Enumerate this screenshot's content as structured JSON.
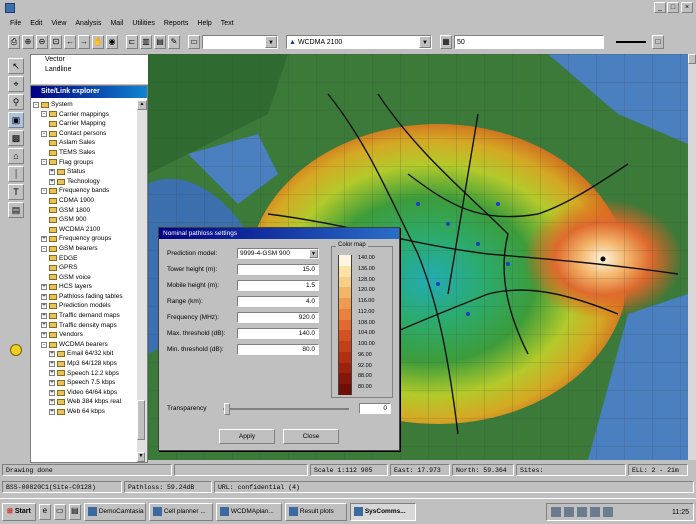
{
  "menu": [
    "File",
    "Edit",
    "View",
    "Analysis",
    "Mail",
    "Utilities",
    "Reports",
    "Help",
    "Text"
  ],
  "toolbar": {
    "network_select": "WCDMA 2100",
    "value_field": "50"
  },
  "vector_panel": {
    "items": [
      "Vector",
      "Landline"
    ]
  },
  "explorer": {
    "title": "Site/Link explorer",
    "tree": [
      {
        "label": "System",
        "level": 0,
        "exp": "-"
      },
      {
        "label": "Carrier mappings",
        "level": 1,
        "exp": "-"
      },
      {
        "label": "Carrier Mapping",
        "level": 2,
        "exp": ""
      },
      {
        "label": "Contact persons",
        "level": 1,
        "exp": "-"
      },
      {
        "label": "Aslam Sales",
        "level": 2,
        "exp": ""
      },
      {
        "label": "TEMS Sales",
        "level": 2,
        "exp": ""
      },
      {
        "label": "Flag groups",
        "level": 1,
        "exp": "-"
      },
      {
        "label": "Status",
        "level": 2,
        "exp": "+"
      },
      {
        "label": "Technology",
        "level": 2,
        "exp": "+"
      },
      {
        "label": "Frequency bands",
        "level": 1,
        "exp": "-"
      },
      {
        "label": "CDMA 1900",
        "level": 2,
        "exp": ""
      },
      {
        "label": "GSM 1800",
        "level": 2,
        "exp": ""
      },
      {
        "label": "GSM 900",
        "level": 2,
        "exp": ""
      },
      {
        "label": "WCDMA 2100",
        "level": 2,
        "exp": ""
      },
      {
        "label": "Frequency groups",
        "level": 1,
        "exp": "+"
      },
      {
        "label": "GSM bearers",
        "level": 1,
        "exp": "-"
      },
      {
        "label": "EDGE",
        "level": 2,
        "exp": ""
      },
      {
        "label": "GPRS",
        "level": 2,
        "exp": ""
      },
      {
        "label": "GSM voice",
        "level": 2,
        "exp": ""
      },
      {
        "label": "HCS layers",
        "level": 1,
        "exp": "+"
      },
      {
        "label": "Pathloss fading tables",
        "level": 1,
        "exp": "+"
      },
      {
        "label": "Prediction models",
        "level": 1,
        "exp": "+"
      },
      {
        "label": "Traffic demand maps",
        "level": 1,
        "exp": "+"
      },
      {
        "label": "Traffic density maps",
        "level": 1,
        "exp": "+"
      },
      {
        "label": "Vendors",
        "level": 1,
        "exp": "+"
      },
      {
        "label": "WCDMA bearers",
        "level": 1,
        "exp": "-"
      },
      {
        "label": "Email 64/32 kbit",
        "level": 2,
        "exp": "+"
      },
      {
        "label": "Mp3 64/128 kbps",
        "level": 2,
        "exp": "+"
      },
      {
        "label": "Speech 12.2 kbps",
        "level": 2,
        "exp": "+"
      },
      {
        "label": "Speech 7.5 kbps",
        "level": 2,
        "exp": "+"
      },
      {
        "label": "Video 64/64 kbps",
        "level": 2,
        "exp": "+"
      },
      {
        "label": "Web 384 kbps real",
        "level": 2,
        "exp": "+"
      },
      {
        "label": "Web 64 kbps",
        "level": 2,
        "exp": "+"
      }
    ]
  },
  "dialog": {
    "title": "Nominal pathloss settings",
    "fields": [
      {
        "label": "Prediction model:",
        "value": "9999-4-GSM 900"
      },
      {
        "label": "Tower height (m):",
        "value": "15.0"
      },
      {
        "label": "Mobile height (m):",
        "value": "1.5"
      },
      {
        "label": "Range (km):",
        "value": "4.0"
      },
      {
        "label": "Frequency (MHz):",
        "value": "920.0"
      },
      {
        "label": "Max. threshold (dB):",
        "value": "140.0"
      },
      {
        "label": "Min. threshold (dB):",
        "value": "80.0"
      }
    ],
    "color_map_label": "Color map",
    "legend": [
      "140.00",
      "136.00",
      "128.00",
      "120.00",
      "116.00",
      "112.00",
      "108.00",
      "104.00",
      "100.00",
      "96.00",
      "92.00",
      "88.00",
      "80.00"
    ],
    "legend_colors": [
      "#fdf5e0",
      "#fbe2a6",
      "#f8cf88",
      "#f3b56a",
      "#ee9a52",
      "#e8813e",
      "#de6a2e",
      "#d25322",
      "#c24018",
      "#b03010",
      "#9c220c",
      "#861708",
      "#6e0e05"
    ],
    "transparency_label": "Transparency",
    "transparency_value": "0",
    "apply": "Apply",
    "close": "Close"
  },
  "status": {
    "left": "Drawing done",
    "scale": "Scale 1:112 905",
    "east": "East: 17.973",
    "north": "North: 59.364",
    "sites": "Sites:",
    "ell": "ELL: 2 - 21m",
    "link": "BSS-00820C1(Site-C0128)",
    "pathloss": "Pathloss: 59.24dB",
    "url": "URL: confidential (4)"
  },
  "taskbar": {
    "start": "Start",
    "tasks": [
      "DemoCamtasia",
      "Cell planner ...",
      "WCDMAplan...",
      "Result plots",
      "SysComms..."
    ],
    "clock": "11:25"
  }
}
